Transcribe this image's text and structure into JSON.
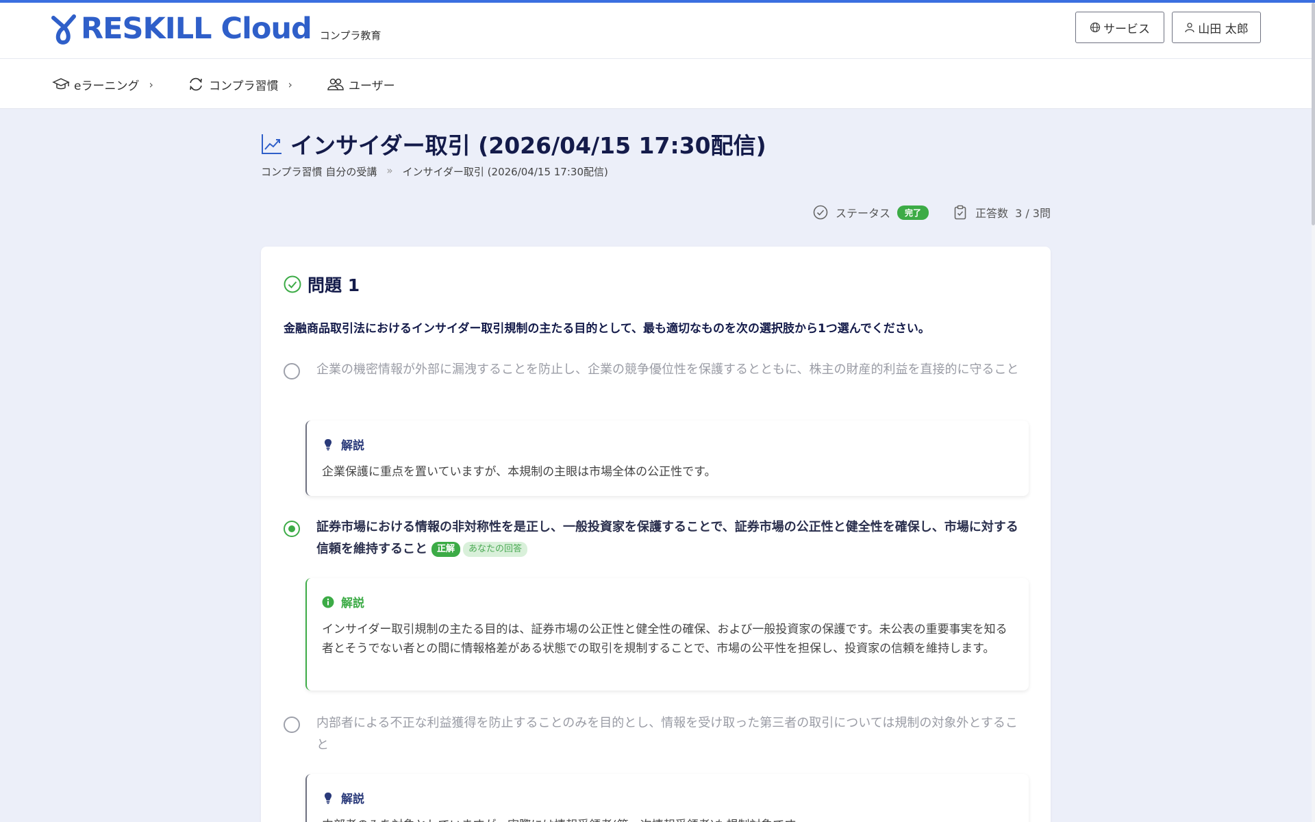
{
  "brand": {
    "logo_text": "RESKILL Cloud",
    "subtitle": "コンプラ教育",
    "primary_color": "#2f5fc9",
    "success_color": "#3cab46"
  },
  "header": {
    "service_button": "サービス",
    "user_button": "山田 太郎"
  },
  "nav": {
    "items": [
      {
        "label": "eラーニング",
        "icon": "graduation-cap-icon"
      },
      {
        "label": "コンプラ習慣",
        "icon": "refresh-icon"
      },
      {
        "label": "ユーザー",
        "icon": "users-icon"
      }
    ]
  },
  "page": {
    "title": "インサイダー取引 (2026/04/15 17:30配信)",
    "breadcrumb": [
      "コンプラ習慣 自分の受講",
      "インサイダー取引 (2026/04/15 17:30配信)"
    ],
    "breadcrumb_sep": "»"
  },
  "stats": {
    "status_label": "ステータス",
    "status_value": "完了",
    "score_label": "正答数",
    "score_value": "3 / 3問"
  },
  "question": {
    "heading": "問題 1",
    "text": "金融商品取引法におけるインサイダー取引規制の主たる目的として、最も適切なものを次の選択肢から1つ選んでください。",
    "options": [
      {
        "text": "企業の機密情報が外部に漏洩することを防止し、企業の競争優位性を保護するとともに、株主の財産的利益を直接的に守ること",
        "explanation_label": "解説",
        "explanation": "企業保護に重点を置いていますが、本規制の主眼は市場全体の公正性です。"
      },
      {
        "text": "証券市場における情報の非対称性を是正し、一般投資家を保護することで、証券市場の公正性と健全性を確保し、市場に対する信頼を維持すること",
        "correct_tag": "正解",
        "your_answer_tag": "あなたの回答",
        "explanation_label": "解説",
        "explanation": "インサイダー取引規制の主たる目的は、証券市場の公正性と健全性の確保、および一般投資家の保護です。未公表の重要事実を知る者とそうでない者との間に情報格差がある状態での取引を規制することで、市場の公平性を担保し、投資家の信頼を維持します。"
      },
      {
        "text": "内部者による不正な利益獲得を防止することのみを目的とし、情報を受け取った第三者の取引については規制の対象外とすること",
        "explanation_label": "解説",
        "explanation": "内部者のみを対象としていますが、実際には情報受領者(第一次情報受領者)も規制対象です。"
      }
    ]
  }
}
